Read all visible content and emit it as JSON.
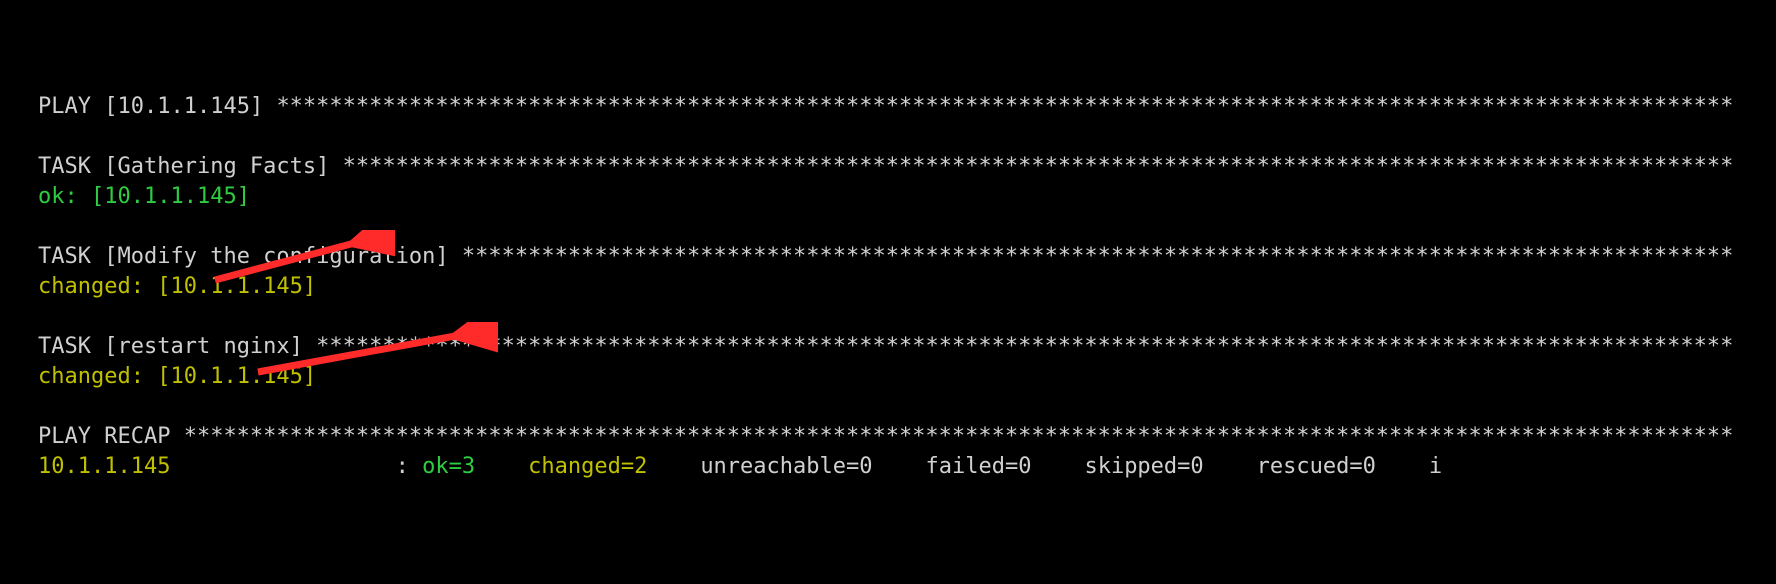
{
  "target_host": "10.1.1.145",
  "play_header_prefix": "PLAY [",
  "play_header_suffix": "] ",
  "task_header_prefix": "TASK [",
  "task_header_suffix": "] ",
  "tasks": {
    "t1_name": "Gathering Facts",
    "t1_status": "ok",
    "t1_host": "10.1.1.145",
    "t2_name": "Modify the configuration",
    "t2_status": "changed",
    "t2_host": "10.1.1.145",
    "t3_name": "restart nginx",
    "t3_status": "changed",
    "t3_host": "10.1.1.145"
  },
  "recap_title": "PLAY RECAP ",
  "recap": {
    "host": "10.1.1.145",
    "ok_label": "ok=",
    "ok_val": "3",
    "changed_label": "changed=",
    "changed_val": "2",
    "unreachable_label": "unreachable=",
    "unreachable_val": "0",
    "failed_label": "failed=",
    "failed_val": "0",
    "skipped_label": "skipped=",
    "skipped_val": "0",
    "rescued_label": "rescued=",
    "rescued_val": "0",
    "overflow": "i"
  },
  "colors": {
    "ok": "#2ecc40",
    "changed": "#c0c000",
    "text": "#d0d0d0",
    "bg": "#000000",
    "arrow": "#ff2a2a"
  }
}
